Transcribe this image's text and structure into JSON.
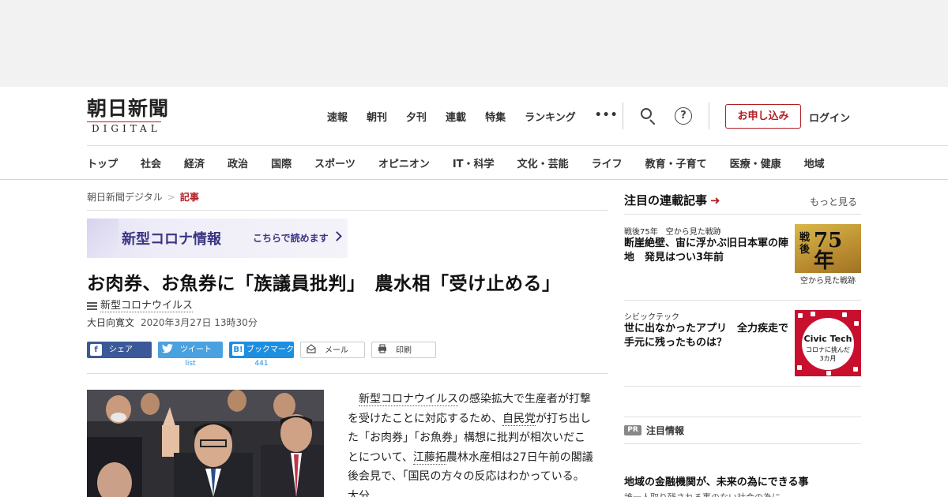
{
  "logo": {
    "main": "朝日新聞",
    "sub": "DIGITAL"
  },
  "topnav": [
    "速報",
    "朝刊",
    "夕刊",
    "連載",
    "特集",
    "ランキング"
  ],
  "topnav_more": "•••",
  "help_glyph": "?",
  "apply_label": "お申し込み",
  "login_label": "ログイン",
  "categories": [
    "トップ",
    "社会",
    "経済",
    "政治",
    "国際",
    "スポーツ",
    "オピニオン",
    "IT・科学",
    "文化・芸能",
    "ライフ",
    "教育・子育て",
    "医療・健康",
    "地域"
  ],
  "breadcrumb": {
    "home": "朝日新聞デジタル",
    "sep": ">",
    "current": "記事"
  },
  "banner": {
    "title": "新型コロナ情報",
    "link": "こちらで読めます"
  },
  "article": {
    "headline": "お肉券、お魚券に「族議員批判」　農水相「受け止める」",
    "tag": "新型コロナウイルス",
    "author": "大日向寛文",
    "date": "2020年3月27日 13時30分",
    "body": {
      "p1": "新型コロナウイルス",
      "p2": "の感染拡大で生産者が打撃を受けたことに対応するため、",
      "p3": "自民党",
      "p4": "が打ち出した「お肉券」「お魚券」構想に批判が相次いだことについて、",
      "p5": "江藤拓",
      "p6": "農林水産相は27日午前の閣議後会見で、「国民の方々の反応はわかっている。大分"
    }
  },
  "share": {
    "facebook": {
      "icon": "f",
      "label": "シェア"
    },
    "twitter": {
      "label": "ツイート",
      "count": "list"
    },
    "hatena": {
      "icon": "B!",
      "label": "ブックマーク",
      "count": "441"
    },
    "mail": {
      "label": "メール"
    },
    "print": {
      "label": "印刷"
    }
  },
  "sidebar": {
    "heading": "注目の連載記事",
    "heading_arrow": "➜",
    "more": "もっと見る",
    "items": [
      {
        "category": "戦後75年　空から見た戦跡",
        "title": "断崖絶壁、宙に浮かぶ旧日本軍の陣地　発見はつい3年前",
        "thumb_kanji": "戦後",
        "thumb_big": "75年",
        "thumb_caption": "空から見た戦跡"
      },
      {
        "category": "シビックテック",
        "title": "世に出なかったアプリ　全力疾走で手元に残ったものは？",
        "thumb_line1": "Civic Tech",
        "thumb_line2": "コロナに挑んだ",
        "thumb_line3": "3カ月"
      }
    ],
    "pr_badge": "PR",
    "pr_label": "注目情報",
    "pr_title": "地域の金融機関が、未来の為にできる事",
    "pr_sub": "誰一人取り残される事のない社会の為に"
  },
  "colors": {
    "brand_red": "#b01e23",
    "facebook": "#3b5998",
    "twitter": "#4aa1e0",
    "hatena": "#1d8fe1",
    "banner_text": "#3b3582"
  }
}
